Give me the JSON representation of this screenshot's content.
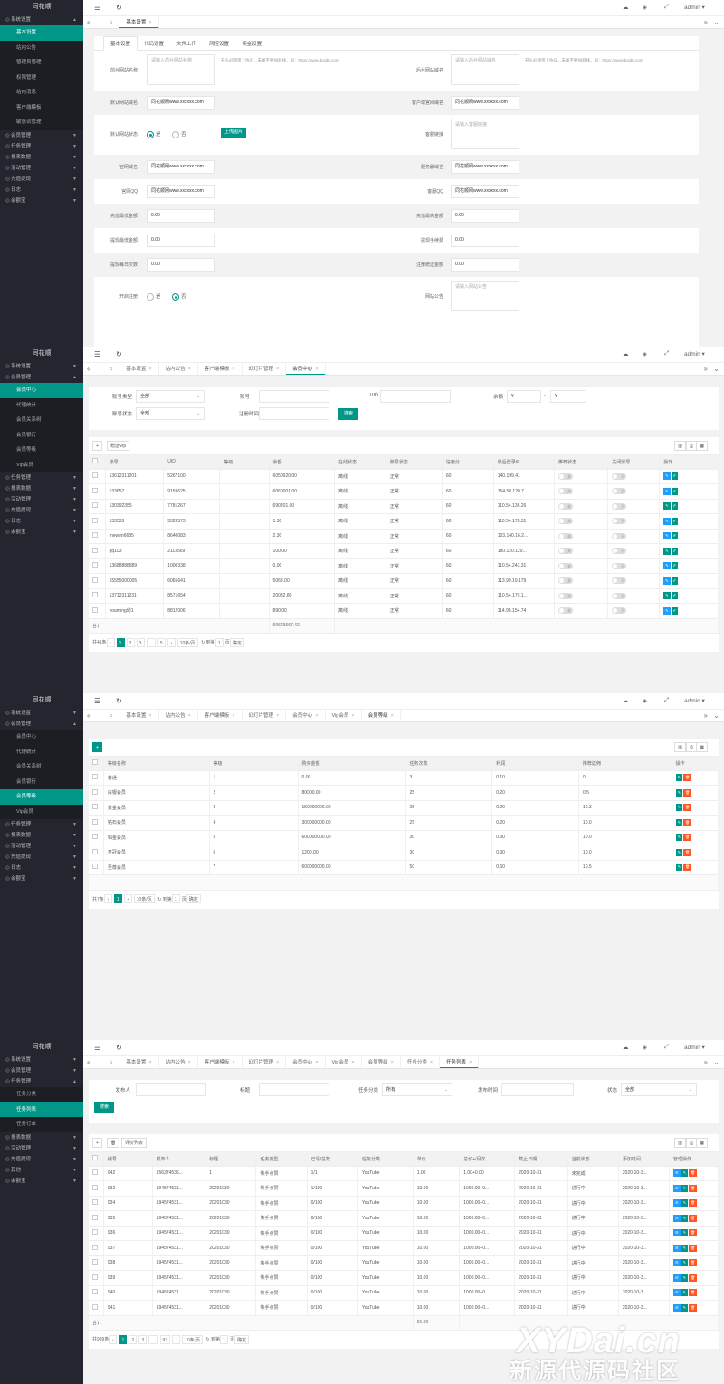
{
  "app": {
    "logo": "同花顺",
    "user": "admin ▾"
  },
  "colors": {
    "sidebar": "#23262e",
    "accent": "#009688",
    "blue": "#1e9fff",
    "orange": "#ff5722"
  },
  "panel1": {
    "nav": [
      {
        "label": "系统设置",
        "open": true,
        "subs": [
          {
            "label": "基本设置",
            "on": true
          },
          {
            "label": "站内公告"
          },
          {
            "label": "管理员管理"
          },
          {
            "label": "权限管理"
          },
          {
            "label": "站内消息"
          },
          {
            "label": "客户端模板"
          },
          {
            "label": "敏感词管理"
          }
        ]
      },
      {
        "label": "会员管理"
      },
      {
        "label": "任务管理"
      },
      {
        "label": "报表数据"
      },
      {
        "label": "活动管理"
      },
      {
        "label": "充值提现"
      },
      {
        "label": "日志"
      },
      {
        "label": "余额宝"
      }
    ],
    "tabs": [
      {
        "label": "基本设置",
        "on": true
      }
    ],
    "subtabs": [
      "基本设置",
      "代码设置",
      "文件上传",
      "风控设置",
      "佣金设置"
    ],
    "rows": [
      {
        "l1": "前台网站名称",
        "v1": "请输入前台网站名称",
        "h1": "开头必须带上协议，末尾不要加斜线，如：https://www.baidu.com",
        "l2": "后台网站域名",
        "v2": "请输入后台网站域名",
        "h2": "开头必须带上协议，末尾不要加斜线，如：https://www.baidu.com",
        "tall": true
      },
      {
        "l1": "默认网站域名",
        "v1": "同花顺网www.xxxxxx.com",
        "l2": "客户端官网域名",
        "v2": "同花顺网www.xxxxxx.com"
      },
      {
        "l1": "默认网站状态",
        "r1": [
          "是",
          "否"
        ],
        "btn": "上传图片",
        "l2": "客服链接",
        "v2": "请输入客服链接",
        "tall": true
      },
      {
        "l1": "官网域名",
        "v1": "同花顺网www.xxxxxx.com",
        "l2": "服务器域名",
        "v2": "同花顺网www.xxxxxx.com"
      },
      {
        "l1": "官网QQ",
        "v1": "同花顺网www.xxxxxx.com",
        "l2": "客服QQ",
        "v2": "同花顺网www.xxxxxx.com"
      },
      {
        "l1": "充值最低金额",
        "v1": "0.00",
        "l2": "充值最高金额",
        "v2": "0.00"
      },
      {
        "l1": "提现最低金额",
        "v1": "0.00",
        "l2": "提现手续费",
        "v2": "0.00"
      },
      {
        "l1": "提现每日次数",
        "v1": "0.00",
        "l2": "注册赠送金额",
        "v2": "0.00"
      },
      {
        "l1": "开启注册",
        "r1": [
          "是",
          "否"
        ],
        "l2": "网站公告",
        "v2": "请输入网站公告",
        "tall": true
      }
    ]
  },
  "panel2": {
    "nav": [
      {
        "label": "系统设置"
      },
      {
        "label": "会员管理",
        "open": true,
        "subs": [
          {
            "label": "会员中心",
            "on": true
          },
          {
            "label": "代理统计"
          },
          {
            "label": "会员关系树"
          },
          {
            "label": "会员银行"
          },
          {
            "label": "会员等级"
          },
          {
            "label": "Vip会员"
          }
        ]
      },
      {
        "label": "任务管理"
      },
      {
        "label": "报表数据"
      },
      {
        "label": "活动管理"
      },
      {
        "label": "充值提现"
      },
      {
        "label": "日志"
      },
      {
        "label": "余额宝"
      }
    ],
    "tabs": [
      {
        "label": "基本设置"
      },
      {
        "label": "站内公告"
      },
      {
        "label": "客户端模板"
      },
      {
        "label": "幻灯片管理"
      },
      {
        "label": "会员中心",
        "on": true
      }
    ],
    "filters": {
      "acct_type_l": "账号类型",
      "acct_type": "全部",
      "acct_l": "账号",
      "uid_l": "UID",
      "bal_l": "余额",
      "bal_a": "¥",
      "bal_b": "¥",
      "acct_status_l": "账号状态",
      "acct_status": "全部",
      "reg_l": "注册时间",
      "search": "搜索"
    },
    "toolbar": {
      "add": "+",
      "btn": "赠送Vip"
    },
    "headers": [
      "",
      "账号",
      "UID",
      "等级",
      "余额",
      "在线状态",
      "账号状态",
      "信用分",
      "最后登录IP",
      "推荐状态",
      "关闭账号",
      "操作"
    ],
    "rows": [
      [
        "13612311201",
        "5267100",
        "",
        "6050920.00",
        "离线",
        "正常",
        "60",
        "140.199.41",
        "关",
        "开"
      ],
      [
        "133657",
        "9159625",
        "",
        "6060001.00",
        "离线",
        "正常",
        "60",
        "154.58.120.7",
        "关",
        "开"
      ],
      [
        "130392355",
        "7781267",
        "",
        "690201.00",
        "离线",
        "正常",
        "60",
        "110.54.136.26",
        "关",
        "开"
      ],
      [
        "133533",
        "3323573",
        "",
        "1.30",
        "离线",
        "正常",
        "60",
        "110.54.178.31",
        "关",
        "开"
      ],
      [
        "mewen6685",
        "8640083",
        "",
        "2.30",
        "离线",
        "正常",
        "60",
        "103.140.16.2...",
        "关",
        "开"
      ],
      [
        "qq103",
        "2113569",
        "",
        "100.00",
        "离线",
        "正常",
        "60",
        "180.120.129...",
        "关",
        "开"
      ],
      [
        "13688888889",
        "1000338",
        "",
        "0.00",
        "离线",
        "正常",
        "60",
        "110.54.243.31",
        "关",
        "开"
      ],
      [
        "15555000005",
        "6065641",
        "",
        "5063.00",
        "离线",
        "正常",
        "60",
        "113.99.19.179",
        "关",
        "开"
      ],
      [
        "13712311231",
        "8571654",
        "",
        "20032.80",
        "离线",
        "正常",
        "60",
        "110.54.179.1...",
        "关",
        "开"
      ],
      [
        "younnng幼1",
        "8812006",
        "",
        "890.00",
        "离线",
        "正常",
        "60",
        "114.95.154.74",
        "关",
        "开"
      ]
    ],
    "total_label": "合计",
    "total": "60623667.42",
    "pager": {
      "count": "共41条",
      "pages": [
        "1",
        "2",
        "3",
        "...",
        "5"
      ],
      "size": "10条/页",
      "go_l": "到第",
      "go": "1",
      "page": "页",
      "confirm": "确定"
    }
  },
  "panel3": {
    "nav": [
      {
        "label": "系统设置"
      },
      {
        "label": "会员管理",
        "open": true,
        "subs": [
          {
            "label": "会员中心"
          },
          {
            "label": "代理统计"
          },
          {
            "label": "会员关系树"
          },
          {
            "label": "会员银行"
          },
          {
            "label": "会员等级",
            "on": true
          },
          {
            "label": "Vip会员"
          }
        ]
      },
      {
        "label": "任务管理"
      },
      {
        "label": "报表数据"
      },
      {
        "label": "活动管理"
      },
      {
        "label": "充值提现"
      },
      {
        "label": "日志"
      },
      {
        "label": "余额宝"
      }
    ],
    "tabs": [
      {
        "label": "基本设置"
      },
      {
        "label": "站内公告"
      },
      {
        "label": "客户端模板"
      },
      {
        "label": "幻灯片管理"
      },
      {
        "label": "会员中心"
      },
      {
        "label": "Vip会员"
      },
      {
        "label": "会员等级",
        "on": true
      }
    ],
    "headers": [
      "",
      "等级名称",
      "等级",
      "购买金额",
      "任务次数",
      "利润",
      "推荐返佣",
      "操作"
    ],
    "rows": [
      [
        "普通",
        "1",
        "0.00",
        "3",
        "0.10",
        "0"
      ],
      [
        "白银会员",
        "2",
        "80000.00",
        "25",
        "0.20",
        "0.5"
      ],
      [
        "黄金会员",
        "3",
        "150000000.00",
        "25",
        "0.20",
        "10.3"
      ],
      [
        "钻石会员",
        "4",
        "300000000.00",
        "25",
        "0.20",
        "10.0"
      ],
      [
        "铂金会员",
        "5",
        "600000000.00",
        "30",
        "0.30",
        "10.0"
      ],
      [
        "皇冠会员",
        "6",
        "1200.00",
        "30",
        "0.30",
        "10.0"
      ],
      [
        "至尊会员",
        "7",
        "600000000.00",
        "50",
        "0.50",
        "10.5"
      ]
    ],
    "pager": {
      "count": "共7条",
      "pages": [
        "1"
      ],
      "size": "10条/页",
      "go_l": "到第",
      "go": "1",
      "page": "页",
      "confirm": "确定"
    }
  },
  "panel4": {
    "nav": [
      {
        "label": "系统设置"
      },
      {
        "label": "会员管理"
      },
      {
        "label": "任务管理",
        "open": true,
        "subs": [
          {
            "label": "任务分类"
          },
          {
            "label": "任务列表",
            "on": true
          },
          {
            "label": "任务订单"
          }
        ]
      },
      {
        "label": "报表数据"
      },
      {
        "label": "活动管理"
      },
      {
        "label": "充值提现"
      },
      {
        "label": "其他"
      },
      {
        "label": "余额宝"
      }
    ],
    "tabs": [
      {
        "label": "基本设置"
      },
      {
        "label": "站内公告"
      },
      {
        "label": "客户端模板"
      },
      {
        "label": "幻灯片管理"
      },
      {
        "label": "会员中心"
      },
      {
        "label": "Vip会员"
      },
      {
        "label": "会员等级"
      },
      {
        "label": "任务分类"
      },
      {
        "label": "任务列表",
        "on": true
      }
    ],
    "filters": {
      "pub_l": "发布人",
      "title_l": "标题",
      "cat_l": "任务分类",
      "cat": "所有",
      "time_l": "发布时间",
      "status_l": "状态",
      "status": "全部",
      "search": "搜索"
    },
    "toolbar": {
      "add": "+",
      "del": "🗑",
      "btn": "评价列表"
    },
    "headers": [
      "",
      "编号",
      "发布人",
      "标题",
      "任务类型",
      "已领/总数",
      "任务分类",
      "单价",
      "总价+/月次",
      "截止日期",
      "当前状态",
      "添加时间",
      "管理操作"
    ],
    "rows": [
      [
        "942",
        "156374536...",
        "1",
        "快手点赞",
        "1/1",
        "YouTube",
        "1.00",
        "1.00+0.00",
        "2020-10-31",
        "未完成",
        "2020-10-3..."
      ],
      [
        "932",
        "194574531...",
        "20201030",
        "快手点赞",
        "1/100",
        "YouTube",
        "10.00",
        "1000.00+0...",
        "2020-10-31",
        "进行中",
        "2020-10-3..."
      ],
      [
        "934",
        "194574531...",
        "20201030",
        "快手点赞",
        "0/100",
        "YouTube",
        "10.00",
        "1000.00+0...",
        "2020-10-31",
        "进行中",
        "2020-10-3..."
      ],
      [
        "935",
        "194574531...",
        "20201030",
        "快手点赞",
        "0/100",
        "YouTube",
        "10.00",
        "1000.00+0...",
        "2020-10-31",
        "进行中",
        "2020-10-3..."
      ],
      [
        "936",
        "194574531...",
        "20201030",
        "快手点赞",
        "0/100",
        "YouTube",
        "10.00",
        "1000.00+0...",
        "2020-10-31",
        "进行中",
        "2020-10-3..."
      ],
      [
        "937",
        "194574531...",
        "20201030",
        "快手点赞",
        "0/100",
        "YouTube",
        "10.00",
        "1000.00+0...",
        "2020-10-31",
        "进行中",
        "2020-10-3..."
      ],
      [
        "938",
        "194574531...",
        "20201030",
        "快手点赞",
        "0/100",
        "YouTube",
        "10.00",
        "1000.00+0...",
        "2020-10-31",
        "进行中",
        "2020-10-3..."
      ],
      [
        "939",
        "194574531...",
        "20201030",
        "快手点赞",
        "0/100",
        "YouTube",
        "10.00",
        "1000.00+0...",
        "2020-10-31",
        "进行中",
        "2020-10-3..."
      ],
      [
        "940",
        "194574531...",
        "20201030",
        "快手点赞",
        "0/100",
        "YouTube",
        "10.00",
        "1000.00+0...",
        "2020-10-31",
        "进行中",
        "2020-10-3..."
      ],
      [
        "941",
        "194574531...",
        "20201030",
        "快手点赞",
        "0/100",
        "YouTube",
        "10.00",
        "1000.00+0...",
        "2020-10-31",
        "进行中",
        "2020-10-3..."
      ]
    ],
    "total_label": "合计",
    "total": "91.00",
    "pager": {
      "count": "共939条",
      "pages": [
        "1",
        "2",
        "3",
        "...",
        "93"
      ],
      "size": "10条/页",
      "go_l": "到第",
      "go": "1",
      "page": "页",
      "confirm": "确定"
    }
  },
  "watermark": {
    "line1": "XYDai.cn",
    "line2": "新源代源码社区"
  }
}
